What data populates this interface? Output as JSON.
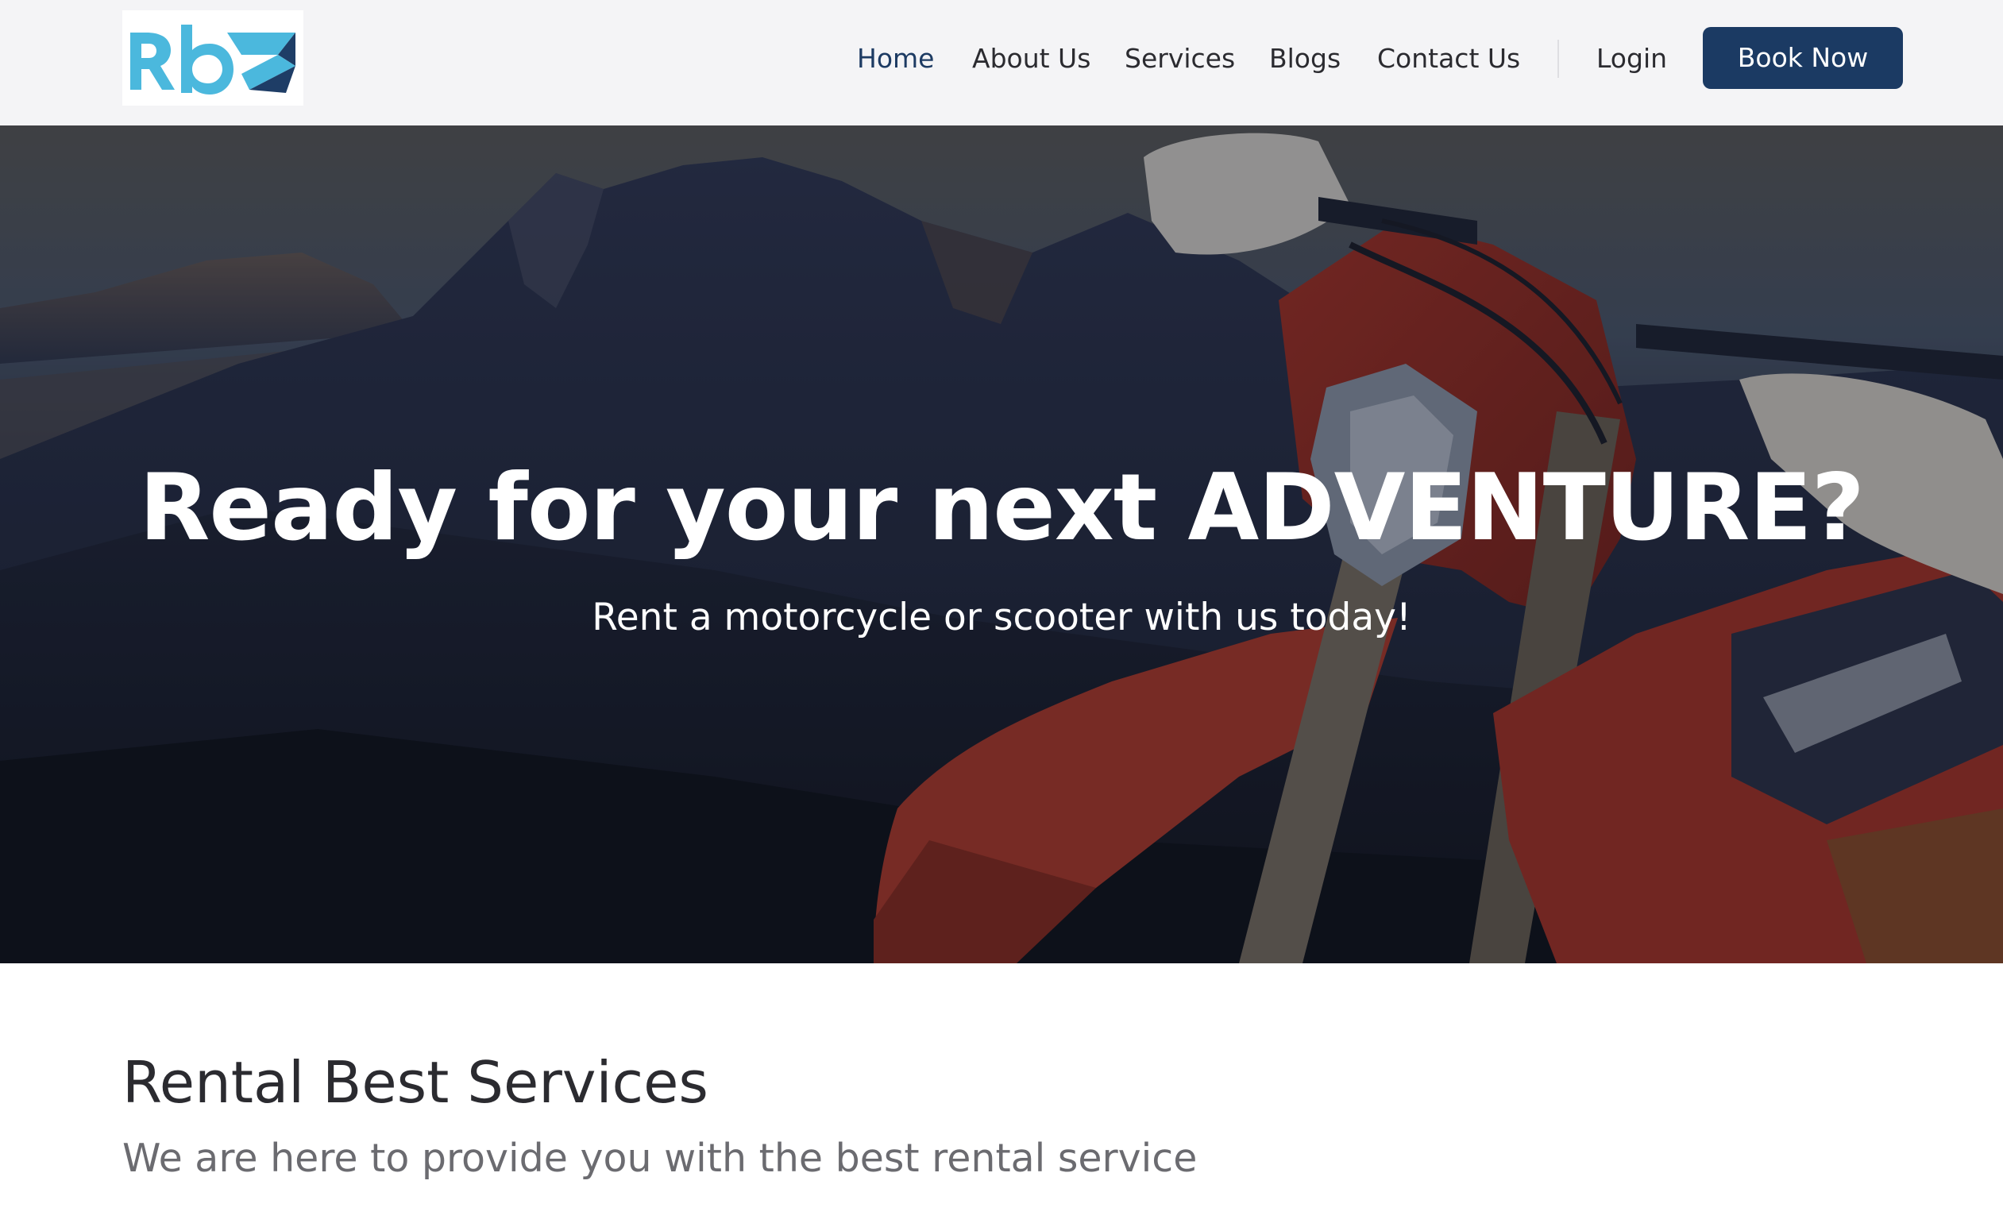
{
  "brand": {
    "logo_name": "rbz-logo",
    "colors": {
      "logo_blue": "#4bb8dd",
      "logo_navy": "#1e3d66",
      "accent": "#1b3a63"
    }
  },
  "nav": {
    "items": [
      {
        "label": "Home",
        "active": true
      },
      {
        "label": "About Us",
        "active": false
      },
      {
        "label": "Services",
        "active": false
      },
      {
        "label": "Blogs",
        "active": false
      },
      {
        "label": "Contact Us",
        "active": false
      }
    ],
    "login_label": "Login",
    "cta_label": "Book Now"
  },
  "hero": {
    "title": "Ready for your next ADVENTURE?",
    "subtitle": "Rent a motorcycle or scooter with us today!"
  },
  "services": {
    "title": "Rental Best Services",
    "subtitle": "We are here to provide you with the best rental service"
  }
}
